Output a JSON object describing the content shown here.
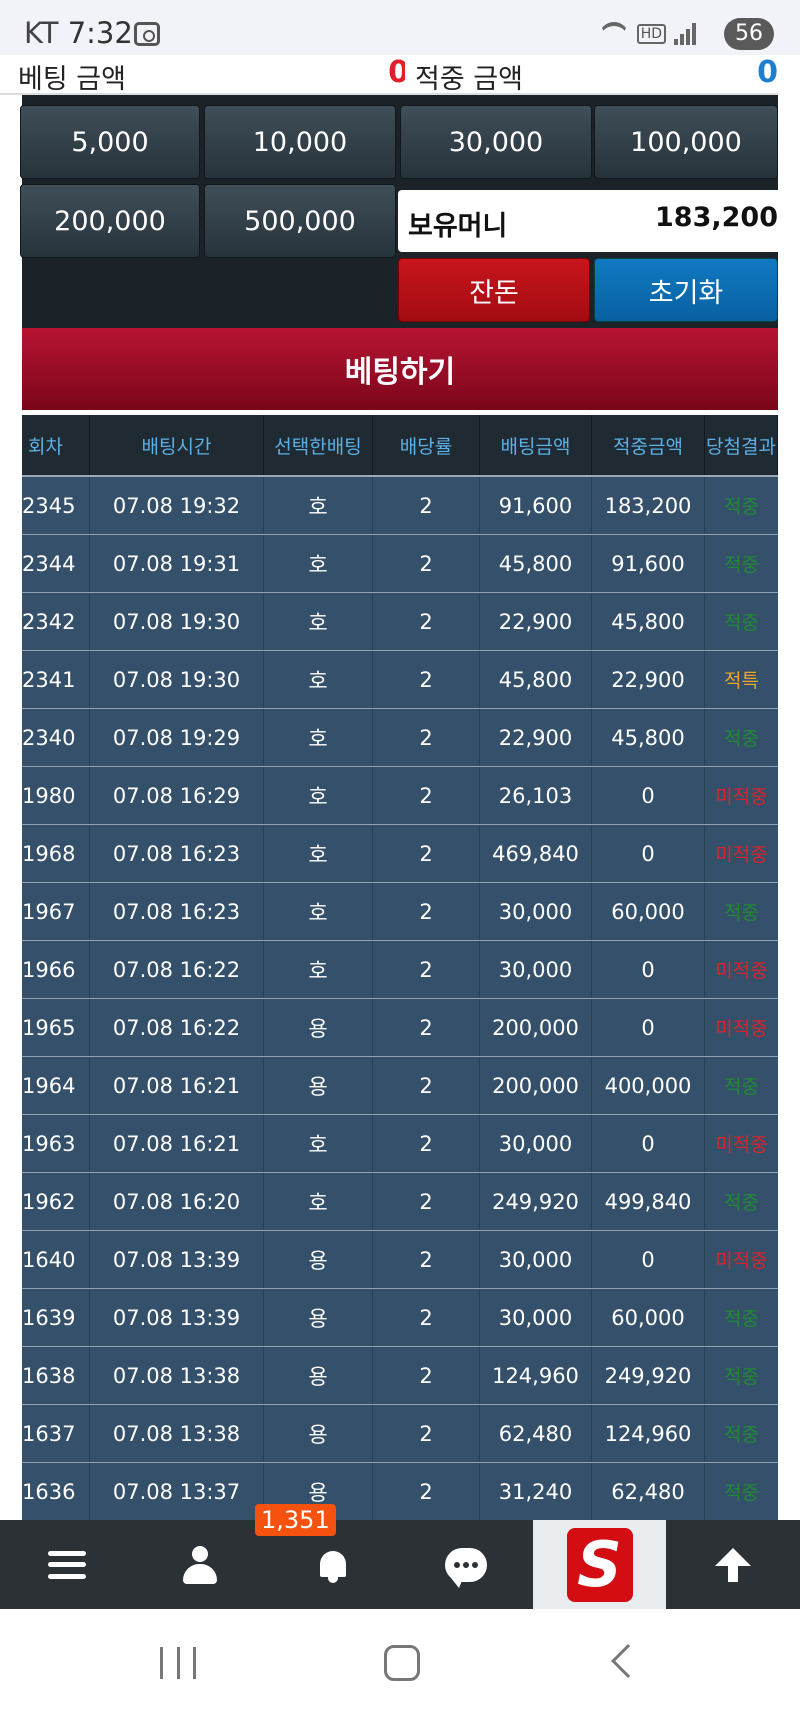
{
  "status_bar": {
    "carrier": "KT",
    "time": "7:32",
    "battery": "56"
  },
  "bet_panel": {
    "bet_amount_label": "베팅 금액",
    "bet_amount_value": "0",
    "hit_amount_label": "적중 금액",
    "hit_amount_value": "0",
    "chips": [
      "5,000",
      "10,000",
      "30,000",
      "100,000",
      "200,000",
      "500,000"
    ],
    "money_label": "보유머니",
    "money_value": "183,200",
    "change_button": "잔돈",
    "reset_button": "초기화",
    "bet_button": "베팅하기"
  },
  "table": {
    "headers": [
      "회차",
      "배팅시간",
      "선택한배팅",
      "배당률",
      "배팅금액",
      "적중금액",
      "당첨결과"
    ],
    "rows": [
      {
        "round": "2345",
        "time": "07.08 19:32",
        "pick": "호",
        "odds": "2",
        "bet": "91,600",
        "win": "183,200",
        "result": "적중",
        "status": "win"
      },
      {
        "round": "2344",
        "time": "07.08 19:31",
        "pick": "호",
        "odds": "2",
        "bet": "45,800",
        "win": "91,600",
        "result": "적중",
        "status": "win"
      },
      {
        "round": "2342",
        "time": "07.08 19:30",
        "pick": "호",
        "odds": "2",
        "bet": "22,900",
        "win": "45,800",
        "result": "적중",
        "status": "win"
      },
      {
        "round": "2341",
        "time": "07.08 19:30",
        "pick": "호",
        "odds": "2",
        "bet": "45,800",
        "win": "22,900",
        "result": "적특",
        "status": "special"
      },
      {
        "round": "2340",
        "time": "07.08 19:29",
        "pick": "호",
        "odds": "2",
        "bet": "22,900",
        "win": "45,800",
        "result": "적중",
        "status": "win"
      },
      {
        "round": "1980",
        "time": "07.08 16:29",
        "pick": "호",
        "odds": "2",
        "bet": "26,103",
        "win": "0",
        "result": "미적중",
        "status": "lose"
      },
      {
        "round": "1968",
        "time": "07.08 16:23",
        "pick": "호",
        "odds": "2",
        "bet": "469,840",
        "win": "0",
        "result": "미적중",
        "status": "lose"
      },
      {
        "round": "1967",
        "time": "07.08 16:23",
        "pick": "호",
        "odds": "2",
        "bet": "30,000",
        "win": "60,000",
        "result": "적중",
        "status": "win"
      },
      {
        "round": "1966",
        "time": "07.08 16:22",
        "pick": "호",
        "odds": "2",
        "bet": "30,000",
        "win": "0",
        "result": "미적중",
        "status": "lose"
      },
      {
        "round": "1965",
        "time": "07.08 16:22",
        "pick": "용",
        "odds": "2",
        "bet": "200,000",
        "win": "0",
        "result": "미적중",
        "status": "lose"
      },
      {
        "round": "1964",
        "time": "07.08 16:21",
        "pick": "용",
        "odds": "2",
        "bet": "200,000",
        "win": "400,000",
        "result": "적중",
        "status": "win"
      },
      {
        "round": "1963",
        "time": "07.08 16:21",
        "pick": "호",
        "odds": "2",
        "bet": "30,000",
        "win": "0",
        "result": "미적중",
        "status": "lose"
      },
      {
        "round": "1962",
        "time": "07.08 16:20",
        "pick": "호",
        "odds": "2",
        "bet": "249,920",
        "win": "499,840",
        "result": "적중",
        "status": "win"
      },
      {
        "round": "1640",
        "time": "07.08 13:39",
        "pick": "용",
        "odds": "2",
        "bet": "30,000",
        "win": "0",
        "result": "미적중",
        "status": "lose"
      },
      {
        "round": "1639",
        "time": "07.08 13:39",
        "pick": "용",
        "odds": "2",
        "bet": "30,000",
        "win": "60,000",
        "result": "적중",
        "status": "win"
      },
      {
        "round": "1638",
        "time": "07.08 13:38",
        "pick": "용",
        "odds": "2",
        "bet": "124,960",
        "win": "249,920",
        "result": "적중",
        "status": "win"
      },
      {
        "round": "1637",
        "time": "07.08 13:38",
        "pick": "용",
        "odds": "2",
        "bet": "62,480",
        "win": "124,960",
        "result": "적중",
        "status": "win"
      },
      {
        "round": "1636",
        "time": "07.08 13:37",
        "pick": "용",
        "odds": "2",
        "bet": "31,240",
        "win": "62,480",
        "result": "적중",
        "status": "win"
      }
    ]
  },
  "bottom_nav": {
    "items": [
      "menu-icon",
      "user-icon",
      "bell-icon",
      "chat-icon",
      "logo-s",
      "arrow-up-icon"
    ],
    "notification_badge": "1,351",
    "logo_letter": "S"
  },
  "colors": {
    "bet_button": "#9e0d26",
    "change_button": "#c8151c",
    "reset_button": "#0b6fb3",
    "header_text": "#5bb0e6",
    "row_bg": "#35506a",
    "win": "#1f8a34",
    "lose": "#d8242c",
    "special": "#e9a629"
  }
}
